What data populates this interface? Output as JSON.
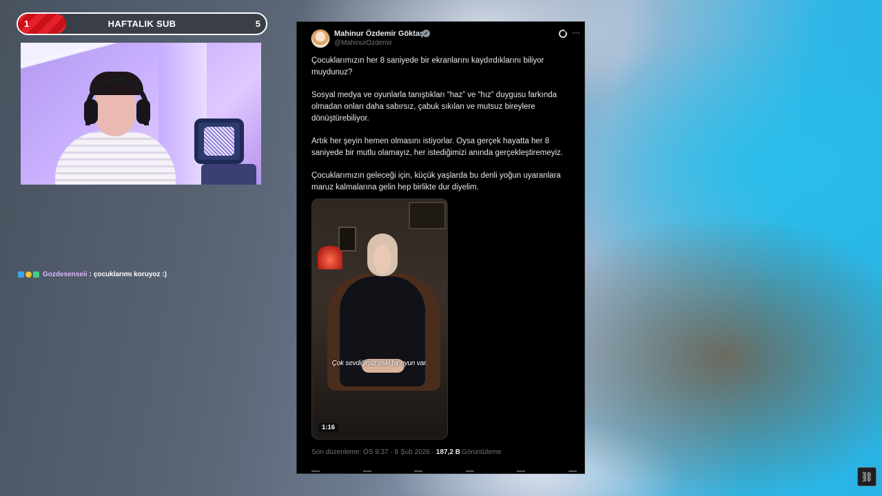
{
  "sub_goal": {
    "current": "1",
    "title": "HAFTALIK SUB",
    "target": "5",
    "progress_fraction": 0.2,
    "fill_color": "#e5202b"
  },
  "webcam": {
    "icon": "webcam-feed"
  },
  "chat": {
    "badges": [
      "badge-blue",
      "badge-gold",
      "badge-green"
    ],
    "username": "Gozdesenseii",
    "separator": ":",
    "message": "çocuklarımı koruyoz :)"
  },
  "tweet": {
    "author_name": "Mahinur Özdemir Göktaş",
    "handle": "@MahinurOzdemir",
    "verified_mark": "✓",
    "more_label": "···",
    "paragraphs": [
      "Çocuklarımızın her 8 saniyede bir ekranlarını kaydırdıklarını biliyor muydunuz?",
      "Sosyal medya ve oyunlarla tanıştıkları “haz” ve “hız” duygusu farkında olmadan onları daha sabırsız, çabuk sıkılan ve mutsuz bireylere dönüştürebiliyor.",
      "Artık her şeyin hemen olmasını istiyorlar. Oysa gerçek hayatta her 8 saniyede bir mutlu olamayız, her istediğimizi anında gerçekleştiremeyiz.",
      "Çocuklarımızın geleceği için, küçük yaşlarda bu denli yoğun uyaranlara maruz kalmalarına gelin hep birlikte dur diyelim."
    ],
    "video": {
      "caption": "Çok sevdiğimiz eski bir oyun var.",
      "duration": "1:16"
    },
    "meta": {
      "edited_prefix": "Son düzenleme: ÖS 9:37 · 8 Şub 2026 ·",
      "views": "187,2 B",
      "views_label": "Görüntüleme"
    },
    "colors": {
      "background": "#000000",
      "text": "#e7e9ea",
      "secondary": "#71767b"
    }
  },
  "channel_logo": {
    "icon": "spider-logo-icon",
    "glyph": "⛓"
  }
}
